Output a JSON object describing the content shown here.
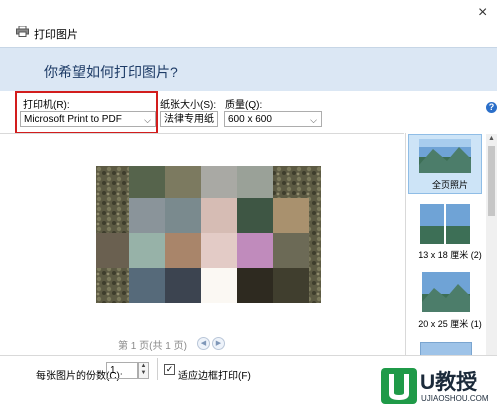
{
  "window": {
    "title": "打印图片",
    "close_glyph": "×"
  },
  "header": {
    "question": "你希望如何打印图片?"
  },
  "options": {
    "printer_label": "打印机(R):",
    "printer_value": "Microsoft Print to PDF",
    "paper_label": "纸张大小(S):",
    "paper_value": "法律专用纸",
    "quality_label": "质量(Q):",
    "quality_value": "600 x 600"
  },
  "preview": {
    "page_indicator": "第 1 页(共 1 页)"
  },
  "layouts": [
    {
      "label": "全页照片",
      "selected": true
    },
    {
      "label": "13 x 18 厘米 (2)",
      "selected": false
    },
    {
      "label": "20 x 25 厘米 (1)",
      "selected": false
    }
  ],
  "bottom": {
    "copies_label": "每张图片的份数(C):",
    "copies_value": "1",
    "fit_label": "适应边框打印(F)",
    "fit_checked": true,
    "fit_check_glyph": "✓"
  },
  "watermark": {
    "brand": "U教授",
    "url": "UJIAOSHOU.COM"
  },
  "colors": {
    "highlight_border": "#d21d1d",
    "header_band": "#dbe7f4",
    "accent": "#2b6fc9"
  }
}
